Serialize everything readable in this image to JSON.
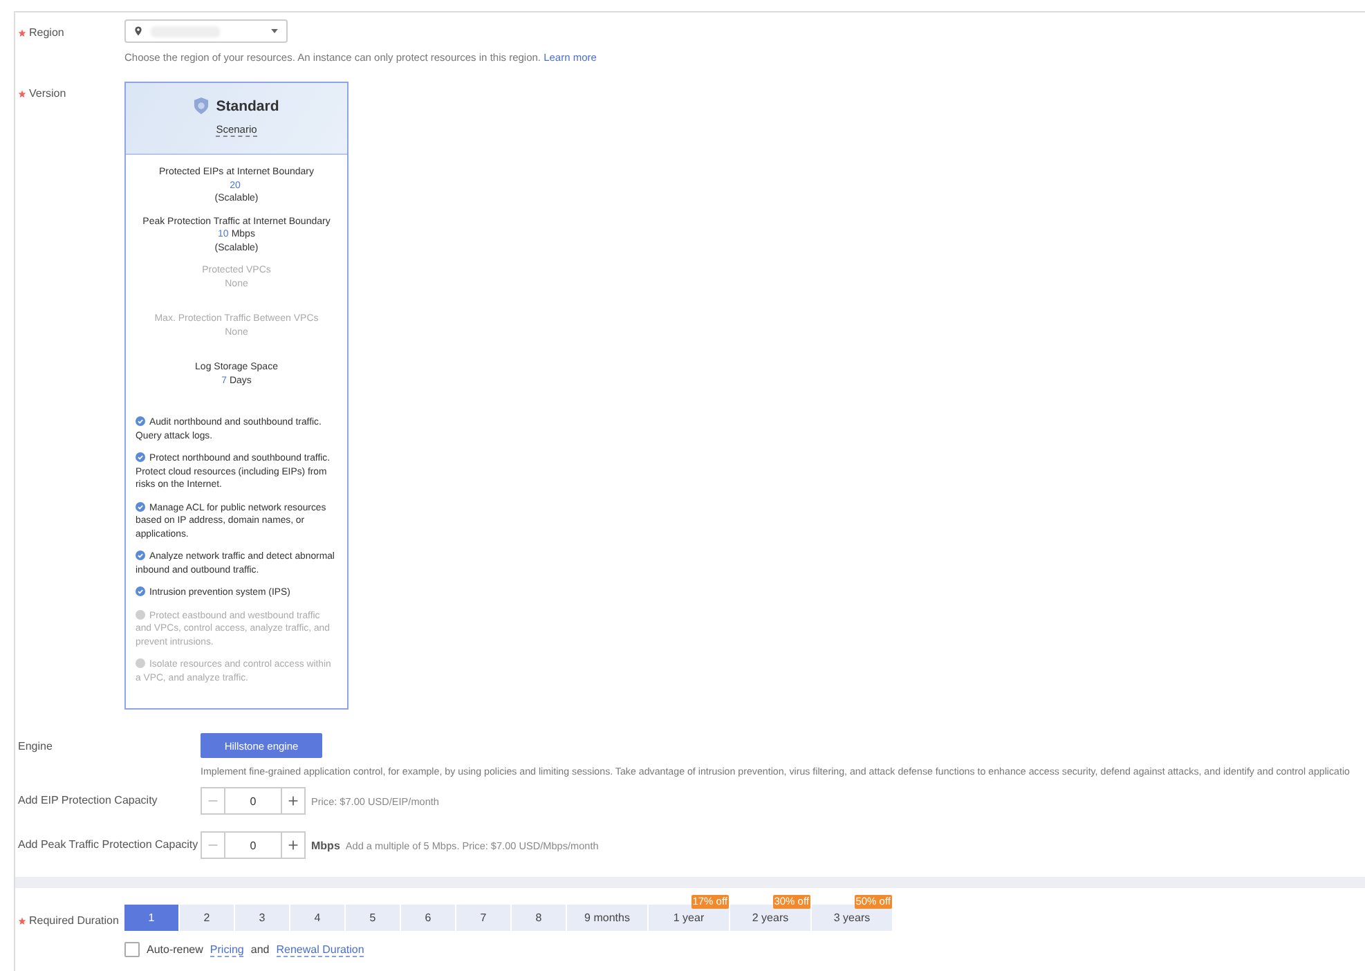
{
  "region": {
    "label": "Region",
    "required": true,
    "help": "Choose the region of your resources. An instance can only protect resources in this region.",
    "help_link": "Learn more"
  },
  "version": {
    "label": "Version",
    "required": true,
    "card": {
      "title": "Standard",
      "subtitle": "Scenario",
      "selected": true,
      "specs": [
        {
          "label": "Protected EIPs at Internet Boundary",
          "number": "20",
          "note": "(Scalable)",
          "enabled": true
        },
        {
          "label": "Peak Protection Traffic at Internet Boundary",
          "number": "10",
          "unit": "Mbps",
          "note": "(Scalable)",
          "enabled": true
        },
        {
          "label": "Protected VPCs",
          "unit": "None",
          "enabled": false
        },
        {
          "label": "Max. Protection Traffic Between VPCs",
          "unit": "None",
          "enabled": false
        },
        {
          "label": "Log Storage Space",
          "number": "7",
          "unit": "Days",
          "enabled": true
        }
      ],
      "features": [
        {
          "text": "Audit northbound and southbound traffic. Query attack logs.",
          "included": true
        },
        {
          "text": "Protect northbound and southbound traffic. Protect cloud resources (including EIPs) from risks on the Internet.",
          "included": true
        },
        {
          "text": "Manage ACL for public network resources based on IP address, domain names, or applications.",
          "included": true
        },
        {
          "text": "Analyze network traffic and detect abnormal inbound and outbound traffic.",
          "included": true
        },
        {
          "text": "Intrusion prevention system (IPS)",
          "included": true
        },
        {
          "text": "Protect eastbound and westbound traffic and VPCs, control access, analyze traffic, and prevent intrusions.",
          "included": false
        },
        {
          "text": "Isolate resources and control access within a VPC, and analyze traffic.",
          "included": false
        }
      ]
    }
  },
  "engine": {
    "label": "Engine",
    "button": "Hillstone engine",
    "description": "Implement fine-grained application control, for example, by using policies and limiting sessions. Take advantage of intrusion prevention, virus filtering, and attack defense functions to enhance access security, defend against attacks, and identify and control applicatio"
  },
  "steppers": [
    {
      "label": "Add EIP Protection Capacity",
      "value": "0",
      "note": "Price: $7.00 USD/EIP/month"
    },
    {
      "label": "Add Peak Traffic Protection Capacity",
      "value": "0",
      "unit": "Mbps",
      "note": "Add a multiple of 5 Mbps. Price: $7.00 USD/Mbps/month"
    }
  ],
  "duration": {
    "label": "Required Duration",
    "required": true,
    "options": [
      {
        "label": "1",
        "selected": true
      },
      {
        "label": "2",
        "selected": false
      },
      {
        "label": "3",
        "selected": false
      },
      {
        "label": "4",
        "selected": false
      },
      {
        "label": "5",
        "selected": false
      },
      {
        "label": "6",
        "selected": false
      },
      {
        "label": "7",
        "selected": false
      },
      {
        "label": "8",
        "selected": false
      },
      {
        "label": "9 months",
        "selected": false
      },
      {
        "label": "1 year",
        "badge": "17% off",
        "selected": false
      },
      {
        "label": "2 years",
        "badge": "30% off",
        "selected": false
      },
      {
        "label": "3 years",
        "badge": "50% off",
        "selected": false
      }
    ],
    "auto_renew": {
      "label": "Auto-renew",
      "checked": false,
      "link1": "Pricing",
      "joiner": "and",
      "link2": "Renewal Duration"
    }
  }
}
